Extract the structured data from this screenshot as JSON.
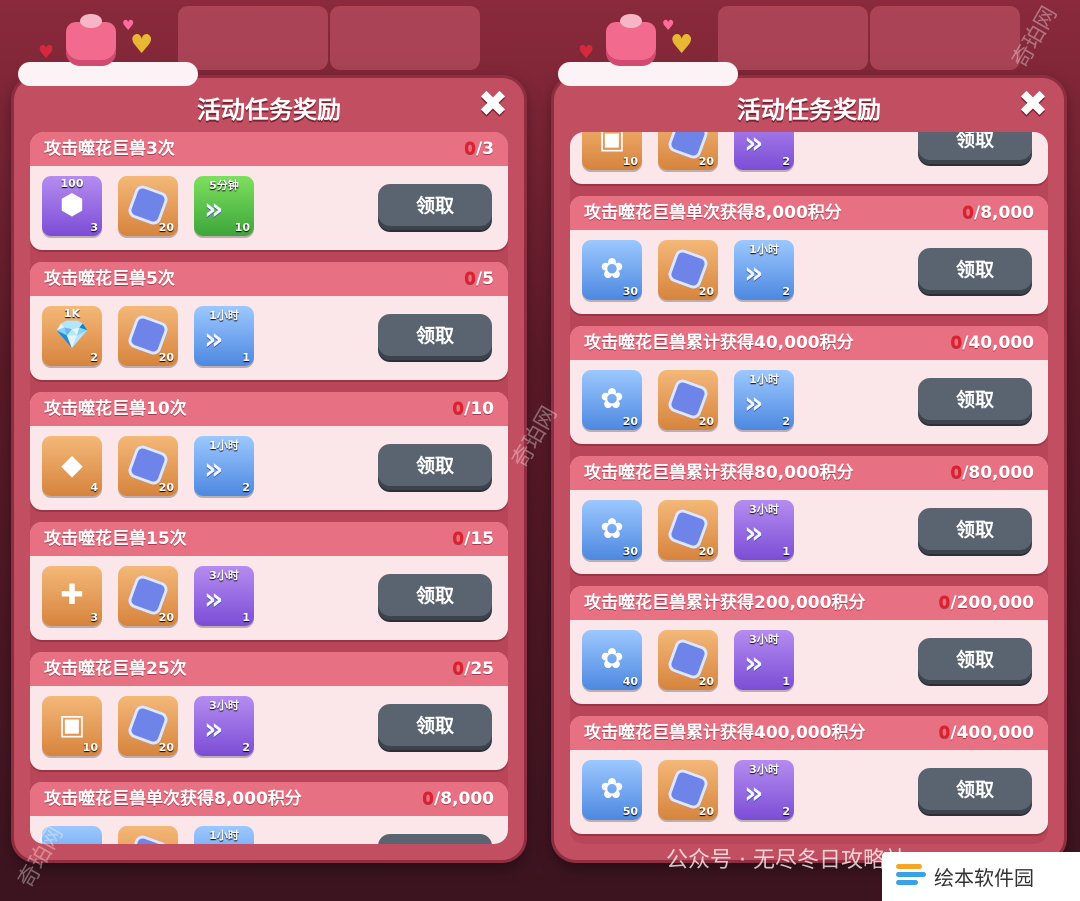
{
  "panel_title": "活动任务奖励",
  "close_glyph": "✖",
  "claim_label": "领取",
  "watermark_side": "奇珀网",
  "footer_wechat": "公众号 · 无尽冬日攻略站",
  "footer_badge": "绘本软件园",
  "left_tasks": [
    {
      "label": "攻击噬花巨兽3次",
      "current": "0",
      "target": "/3",
      "rewards": [
        {
          "kind": "purple",
          "icon": "gear-token-icon",
          "top": "100",
          "count": "3"
        },
        {
          "kind": "orange",
          "icon": "hex-badge-icon",
          "top": "",
          "count": "20"
        },
        {
          "kind": "green",
          "icon": "speedup-icon",
          "top": "5分钟",
          "count": "10"
        }
      ]
    },
    {
      "label": "攻击噬花巨兽5次",
      "current": "0",
      "target": "/5",
      "rewards": [
        {
          "kind": "orange",
          "icon": "gem-bag-icon",
          "top": "1K",
          "count": "2"
        },
        {
          "kind": "orange",
          "icon": "hex-badge-icon",
          "top": "",
          "count": "20"
        },
        {
          "kind": "blue",
          "icon": "speedup-icon",
          "top": "1小时",
          "count": "1"
        }
      ]
    },
    {
      "label": "攻击噬花巨兽10次",
      "current": "0",
      "target": "/10",
      "rewards": [
        {
          "kind": "orange",
          "icon": "stone-icon",
          "top": "",
          "count": "4"
        },
        {
          "kind": "orange",
          "icon": "hex-badge-icon",
          "top": "",
          "count": "20"
        },
        {
          "kind": "blue",
          "icon": "speedup-icon",
          "top": "1小时",
          "count": "2"
        }
      ]
    },
    {
      "label": "攻击噬花巨兽15次",
      "current": "0",
      "target": "/15",
      "rewards": [
        {
          "kind": "orange",
          "icon": "puzzle-icon",
          "top": "",
          "count": "3"
        },
        {
          "kind": "orange",
          "icon": "hex-badge-icon",
          "top": "",
          "count": "20"
        },
        {
          "kind": "purple",
          "icon": "speedup-icon",
          "top": "3小时",
          "count": "1"
        }
      ]
    },
    {
      "label": "攻击噬花巨兽25次",
      "current": "0",
      "target": "/25",
      "rewards": [
        {
          "kind": "orange",
          "icon": "chest-icon",
          "top": "",
          "count": "10"
        },
        {
          "kind": "orange",
          "icon": "hex-badge-icon",
          "top": "",
          "count": "20"
        },
        {
          "kind": "purple",
          "icon": "speedup-icon",
          "top": "3小时",
          "count": "2"
        }
      ]
    },
    {
      "label": "攻击噬花巨兽单次获得8,000积分",
      "current": "0",
      "target": "/8,000",
      "rewards": [
        {
          "kind": "blue",
          "icon": "rose-icon",
          "top": "",
          "count": ""
        },
        {
          "kind": "orange",
          "icon": "hex-badge-icon",
          "top": "",
          "count": ""
        },
        {
          "kind": "blue",
          "icon": "speedup-icon",
          "top": "1小时",
          "count": ""
        }
      ]
    }
  ],
  "right_tasks": [
    {
      "label": "",
      "current": "",
      "target": "",
      "rewards": [
        {
          "kind": "orange",
          "icon": "chest-icon",
          "top": "",
          "count": "10"
        },
        {
          "kind": "orange",
          "icon": "hex-badge-icon",
          "top": "",
          "count": "20"
        },
        {
          "kind": "purple",
          "icon": "speedup-icon",
          "top": "",
          "count": "2"
        }
      ]
    },
    {
      "label": "攻击噬花巨兽单次获得8,000积分",
      "current": "0",
      "target": "/8,000",
      "rewards": [
        {
          "kind": "blue",
          "icon": "rose-icon",
          "top": "",
          "count": "30"
        },
        {
          "kind": "orange",
          "icon": "hex-badge-icon",
          "top": "",
          "count": "20"
        },
        {
          "kind": "blue",
          "icon": "speedup-icon",
          "top": "1小时",
          "count": "2"
        }
      ]
    },
    {
      "label": "攻击噬花巨兽累计获得40,000积分",
      "current": "0",
      "target": "/40,000",
      "rewards": [
        {
          "kind": "blue",
          "icon": "rose-icon",
          "top": "",
          "count": "20"
        },
        {
          "kind": "orange",
          "icon": "hex-badge-icon",
          "top": "",
          "count": "20"
        },
        {
          "kind": "blue",
          "icon": "speedup-icon",
          "top": "1小时",
          "count": "2"
        }
      ]
    },
    {
      "label": "攻击噬花巨兽累计获得80,000积分",
      "current": "0",
      "target": "/80,000",
      "rewards": [
        {
          "kind": "blue",
          "icon": "rose-icon",
          "top": "",
          "count": "30"
        },
        {
          "kind": "orange",
          "icon": "hex-badge-icon",
          "top": "",
          "count": "20"
        },
        {
          "kind": "purple",
          "icon": "speedup-icon",
          "top": "3小时",
          "count": "1"
        }
      ]
    },
    {
      "label": "攻击噬花巨兽累计获得200,000积分",
      "current": "0",
      "target": "/200,000",
      "rewards": [
        {
          "kind": "blue",
          "icon": "rose-icon",
          "top": "",
          "count": "40"
        },
        {
          "kind": "orange",
          "icon": "hex-badge-icon",
          "top": "",
          "count": "20"
        },
        {
          "kind": "purple",
          "icon": "speedup-icon",
          "top": "3小时",
          "count": "1"
        }
      ]
    },
    {
      "label": "攻击噬花巨兽累计获得400,000积分",
      "current": "0",
      "target": "/400,000",
      "rewards": [
        {
          "kind": "blue",
          "icon": "rose-icon",
          "top": "",
          "count": "50"
        },
        {
          "kind": "orange",
          "icon": "hex-badge-icon",
          "top": "",
          "count": "20"
        },
        {
          "kind": "purple",
          "icon": "speedup-icon",
          "top": "3小时",
          "count": "2"
        }
      ]
    }
  ],
  "icon_glyphs": {
    "gear-token-icon": "⬢",
    "gem-bag-icon": "💎",
    "stone-icon": "◆",
    "puzzle-icon": "✚",
    "chest-icon": "▣",
    "rose-icon": "✿"
  }
}
